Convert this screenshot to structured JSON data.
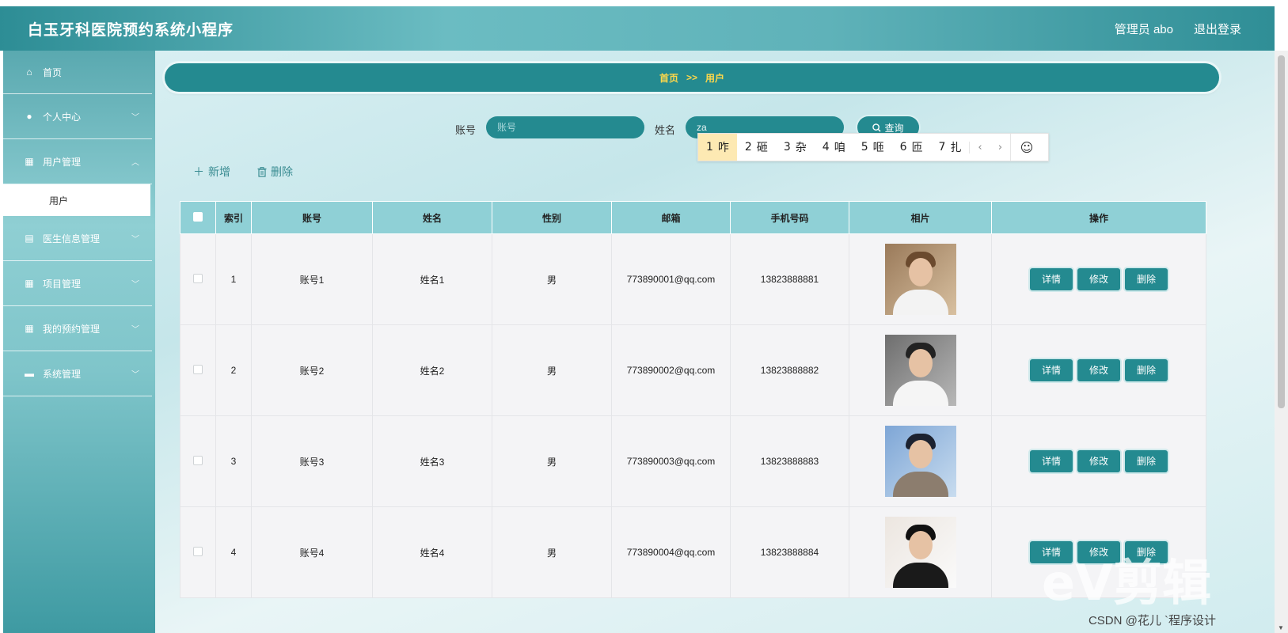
{
  "header": {
    "title": "白玉牙科医院预约系统小程序",
    "admin": "管理员 abo",
    "logout": "退出登录"
  },
  "sidebar": {
    "items": [
      {
        "label": "首页",
        "icon": "home-icon",
        "glyph": "⌂"
      },
      {
        "label": "个人中心",
        "icon": "user-icon",
        "glyph": "●"
      },
      {
        "label": "用户管理",
        "icon": "grid-icon",
        "glyph": "▦"
      },
      {
        "label": "医生信息管理",
        "icon": "clipboard-icon",
        "glyph": "▤"
      },
      {
        "label": "项目管理",
        "icon": "grid-icon",
        "glyph": "▦"
      },
      {
        "label": "我的预约管理",
        "icon": "grid-icon",
        "glyph": "▦"
      },
      {
        "label": "系统管理",
        "icon": "briefcase-icon",
        "glyph": "▬"
      }
    ],
    "sub_item": "用户"
  },
  "breadcrumb": {
    "home": "首页",
    "sep": ">>",
    "current": "用户"
  },
  "search": {
    "account_label": "账号",
    "account_placeholder": "账号",
    "name_label": "姓名",
    "name_value": "za",
    "query_label": "查询"
  },
  "ime": {
    "candidates": [
      {
        "num": "1",
        "char": "咋"
      },
      {
        "num": "2",
        "char": "砸"
      },
      {
        "num": "3",
        "char": "杂"
      },
      {
        "num": "4",
        "char": "咱"
      },
      {
        "num": "5",
        "char": "咂"
      },
      {
        "num": "6",
        "char": "匝"
      },
      {
        "num": "7",
        "char": "扎"
      }
    ],
    "prev": "‹",
    "next": "›",
    "emoji": "☺"
  },
  "actions": {
    "add": "新增",
    "delete": "删除"
  },
  "table": {
    "columns": [
      "索引",
      "账号",
      "姓名",
      "性别",
      "邮箱",
      "手机号码",
      "相片",
      "操作"
    ],
    "rows": [
      {
        "index": "1",
        "account": "账号1",
        "name": "姓名1",
        "gender": "男",
        "email": "773890001@qq.com",
        "phone": "13823888881"
      },
      {
        "index": "2",
        "account": "账号2",
        "name": "姓名2",
        "gender": "男",
        "email": "773890002@qq.com",
        "phone": "13823888882"
      },
      {
        "index": "3",
        "account": "账号3",
        "name": "姓名3",
        "gender": "男",
        "email": "773890003@qq.com",
        "phone": "13823888883"
      },
      {
        "index": "4",
        "account": "账号4",
        "name": "姓名4",
        "gender": "男",
        "email": "773890004@qq.com",
        "phone": "13823888884"
      }
    ],
    "op_detail": "详情",
    "op_edit": "修改",
    "op_delete": "删除"
  },
  "overlay": {
    "watermark": "eV剪辑",
    "csdn": "CSDN @花儿 `程序设计"
  },
  "colors": {
    "primary": "#248a90",
    "header_head": "#8fd0d6",
    "breadcrumb_text": "#ffd84a"
  }
}
